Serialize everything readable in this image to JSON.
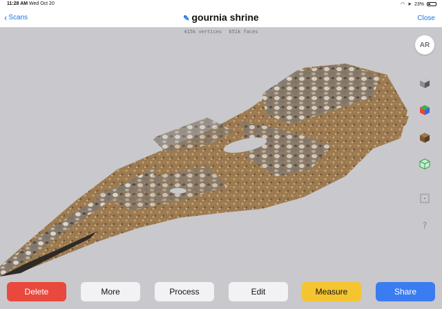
{
  "status_bar": {
    "time": "11:28 AM",
    "date": "Wed Oct 20",
    "battery": "23%"
  },
  "nav": {
    "back_label": "Scans",
    "title": "gournia shrine",
    "close_label": "Close"
  },
  "stats": {
    "vertices": "415k vertices",
    "faces": "651k faces"
  },
  "toolbar": {
    "ar_label": "AR",
    "tools": [
      "gray-cube-icon",
      "color-cube-icon",
      "texture-cube-icon",
      "wireframe-cube-icon",
      "bounding-box-icon",
      "help-icon"
    ]
  },
  "actions": {
    "delete": "Delete",
    "more": "More",
    "process": "Process",
    "edit": "Edit",
    "measure": "Measure",
    "share": "Share"
  },
  "colors": {
    "accent": "#1a73e8",
    "delete": "#e9483d",
    "measure": "#f4c531",
    "share": "#3b7cf0",
    "background": "#c9c8cc"
  }
}
